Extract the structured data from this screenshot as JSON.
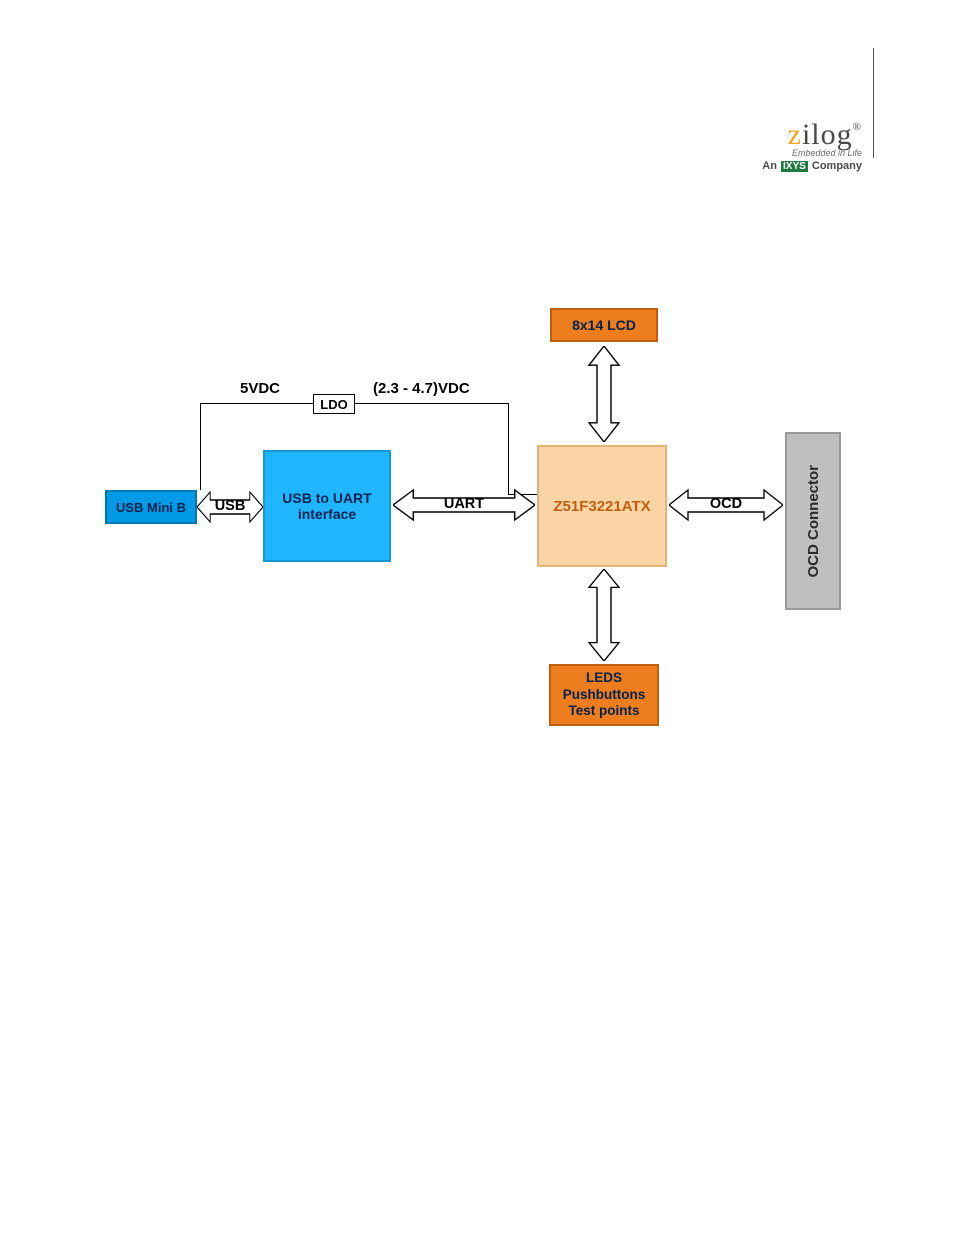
{
  "logo": {
    "z": "z",
    "rest": "ilog",
    "reg": "®",
    "tagline": "Embedded in Life",
    "sub_pre": "An ",
    "sub_box": "IXYS",
    "sub_post": " Company"
  },
  "blocks": {
    "usb_mini_b": "USB Mini B",
    "usb_to_uart": "USB to UART\ninterface",
    "lcd": "8x14 LCD",
    "mcu": "Z51F3221ATX",
    "ocd_conn": "OCD Connector",
    "io": "LEDS\nPushbuttons\nTest points",
    "ldo": "LDO"
  },
  "labels": {
    "usb": "USB",
    "uart": "UART",
    "ocd": "OCD",
    "v5": "5VDC",
    "vreg": "(2.3 - 4.7)VDC"
  }
}
